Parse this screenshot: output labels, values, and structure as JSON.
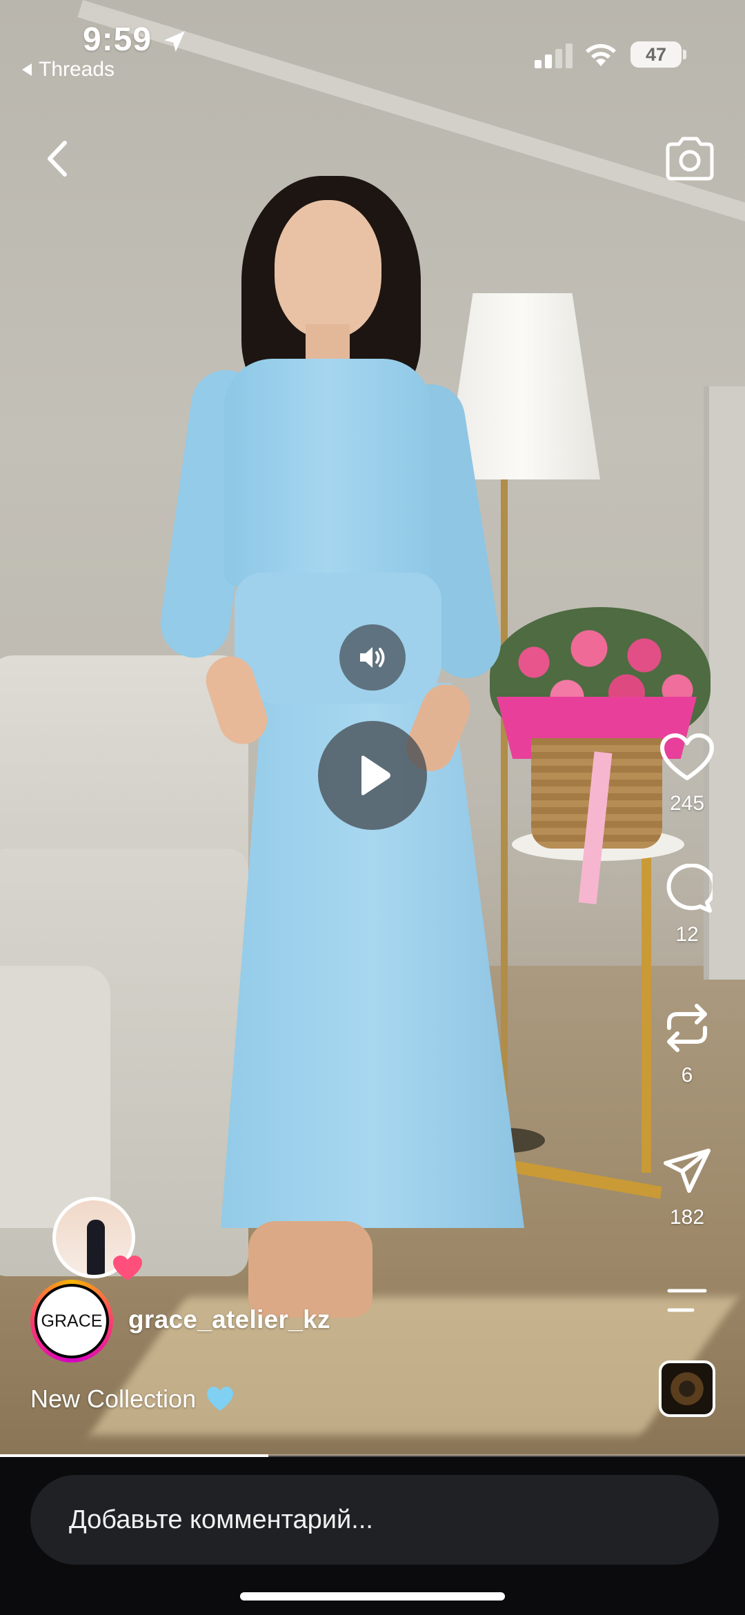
{
  "status_bar": {
    "time": "9:59",
    "back_app": "Threads",
    "battery": "47"
  },
  "icons": {
    "back": "chevron-left-icon",
    "camera": "camera-icon",
    "sound": "speaker-icon",
    "play": "play-icon",
    "like": "heart-icon",
    "comment": "comment-bubble-icon",
    "repost": "repost-icon",
    "share": "paper-plane-icon",
    "more": "menu-lines-icon"
  },
  "actions": {
    "likes": "245",
    "comments": "12",
    "reposts": "6",
    "shares": "182"
  },
  "author": {
    "avatar_text": "GRACE",
    "username": "grace_atelier_kz"
  },
  "caption": {
    "text": "New Collection"
  },
  "playback": {
    "progress_fraction": 0.36
  },
  "comment_box": {
    "placeholder": "Добавьте комментарий..."
  },
  "colors": {
    "caption_heart": "#7fd0f2",
    "story_heart": "#ff4f7a",
    "bottom_bar": "#0b0b0d",
    "input_bg": "#1f2124"
  }
}
